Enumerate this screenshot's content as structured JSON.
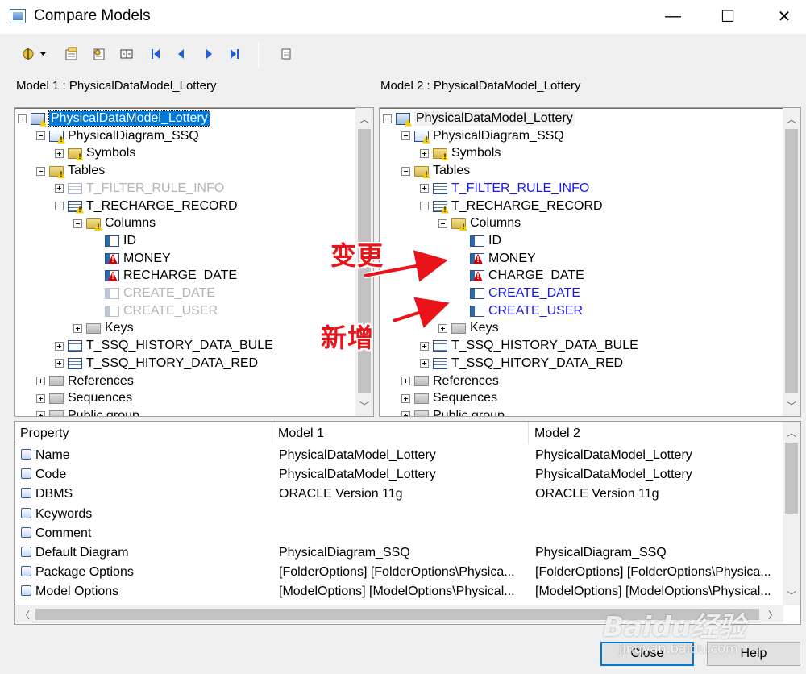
{
  "window": {
    "title": "Compare Models",
    "controls": {
      "minimize": "—",
      "maximize": "☐",
      "close": "✕"
    }
  },
  "toolbar": {
    "buttons": [
      "options-icon",
      "properties-icon",
      "merge-icon",
      "split-view-icon",
      "first-difference-icon",
      "previous-difference-icon",
      "next-difference-icon",
      "last-difference-icon",
      "print-icon"
    ]
  },
  "model1": {
    "label": "Model 1 : PhysicalDataModel_Lottery",
    "tree": [
      {
        "text": "PhysicalDataModel_Lottery",
        "style": "selected",
        "icon": "model",
        "expander": "minus"
      },
      {
        "text": "PhysicalDiagram_SSQ",
        "style": "normal",
        "icon": "diagram",
        "expander": "minus"
      },
      {
        "text": "Symbols",
        "style": "normal",
        "icon": "folder-warn",
        "expander": "plus"
      },
      {
        "text": "Tables",
        "style": "normal",
        "icon": "folder-warn",
        "expander": "minus"
      },
      {
        "text": "T_FILTER_RULE_INFO",
        "style": "gray",
        "icon": "table-gray",
        "expander": "plus"
      },
      {
        "text": "T_RECHARGE_RECORD",
        "style": "normal",
        "icon": "table-warn",
        "expander": "minus"
      },
      {
        "text": "Columns",
        "style": "normal",
        "icon": "folder-warn",
        "expander": "minus"
      },
      {
        "text": "ID",
        "style": "normal",
        "icon": "column",
        "expander": "none"
      },
      {
        "text": "MONEY",
        "style": "normal",
        "icon": "column-red",
        "expander": "none"
      },
      {
        "text": "RECHARGE_DATE",
        "style": "normal",
        "icon": "column-red",
        "expander": "none"
      },
      {
        "text": "CREATE_DATE",
        "style": "gray",
        "icon": "column-gray",
        "expander": "none"
      },
      {
        "text": "CREATE_USER",
        "style": "gray",
        "icon": "column-gray",
        "expander": "none"
      },
      {
        "text": "Keys",
        "style": "normal",
        "icon": "folder-gray",
        "expander": "plus"
      },
      {
        "text": "T_SSQ_HISTORY_DATA_BULE",
        "style": "normal",
        "icon": "table",
        "expander": "plus"
      },
      {
        "text": "T_SSQ_HITORY_DATA_RED",
        "style": "normal",
        "icon": "table",
        "expander": "plus"
      },
      {
        "text": "References",
        "style": "normal",
        "icon": "folder-gray",
        "expander": "plus"
      },
      {
        "text": "Sequences",
        "style": "normal",
        "icon": "folder-gray",
        "expander": "plus"
      },
      {
        "text": "Public group",
        "style": "normal",
        "icon": "folder-gray",
        "expander": "plus"
      }
    ]
  },
  "model2": {
    "label": "Model 2 : PhysicalDataModel_Lottery",
    "tree": [
      {
        "text": "PhysicalDataModel_Lottery",
        "style": "hl",
        "icon": "model",
        "expander": "minus"
      },
      {
        "text": "PhysicalDiagram_SSQ",
        "style": "normal",
        "icon": "diagram",
        "expander": "minus"
      },
      {
        "text": "Symbols",
        "style": "normal",
        "icon": "folder-warn",
        "expander": "plus"
      },
      {
        "text": "Tables",
        "style": "normal",
        "icon": "folder-warn",
        "expander": "minus"
      },
      {
        "text": "T_FILTER_RULE_INFO",
        "style": "blue",
        "icon": "table",
        "expander": "plus"
      },
      {
        "text": "T_RECHARGE_RECORD",
        "style": "normal",
        "icon": "table-warn",
        "expander": "minus"
      },
      {
        "text": "Columns",
        "style": "normal",
        "icon": "folder-warn",
        "expander": "minus"
      },
      {
        "text": "ID",
        "style": "normal",
        "icon": "column",
        "expander": "none"
      },
      {
        "text": "MONEY",
        "style": "normal",
        "icon": "column-red",
        "expander": "none"
      },
      {
        "text": "CHARGE_DATE",
        "style": "normal",
        "icon": "column-red",
        "expander": "none"
      },
      {
        "text": "CREATE_DATE",
        "style": "blue",
        "icon": "column",
        "expander": "none"
      },
      {
        "text": "CREATE_USER",
        "style": "blue",
        "icon": "column",
        "expander": "none"
      },
      {
        "text": "Keys",
        "style": "normal",
        "icon": "folder-gray",
        "expander": "plus"
      },
      {
        "text": "T_SSQ_HISTORY_DATA_BULE",
        "style": "normal",
        "icon": "table",
        "expander": "plus"
      },
      {
        "text": "T_SSQ_HITORY_DATA_RED",
        "style": "normal",
        "icon": "table",
        "expander": "plus"
      },
      {
        "text": "References",
        "style": "normal",
        "icon": "folder-gray",
        "expander": "plus"
      },
      {
        "text": "Sequences",
        "style": "normal",
        "icon": "folder-gray",
        "expander": "plus"
      },
      {
        "text": "Public group",
        "style": "normal",
        "icon": "folder-gray",
        "expander": "plus"
      }
    ]
  },
  "annotations": {
    "changed": "变更",
    "added": "新增",
    "color": "#e8141a"
  },
  "properties": {
    "headers": [
      "Property",
      "Model 1",
      "Model 2"
    ],
    "rows": [
      {
        "property": "Name",
        "model1": "PhysicalDataModel_Lottery",
        "model2": "PhysicalDataModel_Lottery"
      },
      {
        "property": "Code",
        "model1": "PhysicalDataModel_Lottery",
        "model2": "PhysicalDataModel_Lottery"
      },
      {
        "property": "DBMS",
        "model1": "ORACLE Version 11g",
        "model2": "ORACLE Version 11g"
      },
      {
        "property": "Keywords",
        "model1": "",
        "model2": ""
      },
      {
        "property": "Comment",
        "model1": "",
        "model2": ""
      },
      {
        "property": "Default Diagram",
        "model1": "PhysicalDiagram_SSQ",
        "model2": "PhysicalDiagram_SSQ"
      },
      {
        "property": "Package Options",
        "model1": "[FolderOptions]  [FolderOptions\\Physica...",
        "model2": "[FolderOptions]  [FolderOptions\\Physica..."
      },
      {
        "property": "Model Options",
        "model1": "[ModelOptions]  [ModelOptions\\Physical...",
        "model2": "[ModelOptions]  [ModelOptions\\Physical..."
      }
    ]
  },
  "buttons": {
    "close": "Close",
    "help": "Help"
  },
  "watermark": {
    "brand": "Baidu经验",
    "url": "jingyan.baidu.com"
  }
}
